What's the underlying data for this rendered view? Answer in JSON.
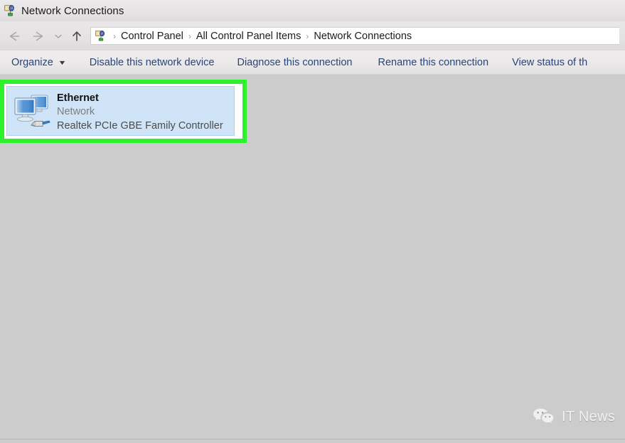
{
  "window": {
    "title": "Network Connections",
    "title_icon": "network-connections-icon"
  },
  "navigation": {
    "back_icon": "arrow-left-icon",
    "forward_icon": "arrow-right-icon",
    "recent_icon": "chevron-down-icon",
    "up_icon": "arrow-up-icon",
    "breadcrumb_icon": "network-connections-icon",
    "separator": "›",
    "crumbs": [
      {
        "label": "Control Panel"
      },
      {
        "label": "All Control Panel Items"
      },
      {
        "label": "Network Connections"
      }
    ]
  },
  "toolbar": {
    "organize_label": "Organize",
    "organize_caret": "▼",
    "disable_label": "Disable this network device",
    "diagnose_label": "Diagnose this connection",
    "rename_label": "Rename this connection",
    "view_status_label": "View status of th"
  },
  "connections": [
    {
      "icon": "network-adapter-icon",
      "name": "Ethernet",
      "status": "Network",
      "device": "Realtek PCIe GBE Family Controller",
      "selected": true,
      "highlighted": true
    }
  ],
  "annotation": {
    "highlight_color": "#2bf22b",
    "target": "Ethernet"
  },
  "watermark": {
    "logo_icon": "wechat-icon",
    "text": "IT News"
  },
  "colors": {
    "selection_fill": "#cfe4f7",
    "selection_border": "#a8d0ef",
    "content_background": "#cccccc",
    "toolbar_link": "#28457a",
    "annotation_green": "#2bf22b"
  }
}
